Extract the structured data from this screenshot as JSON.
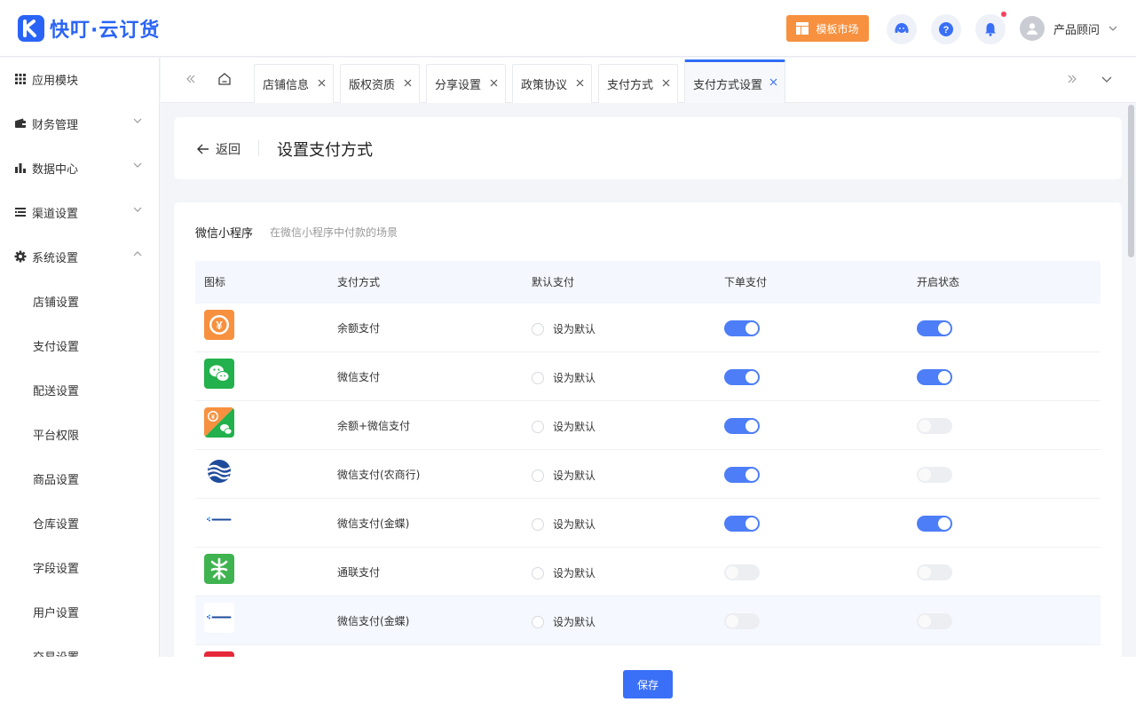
{
  "header": {
    "logo_text": "快叮·云订货",
    "template_market": "模板市场",
    "user_name": "产品顾问"
  },
  "sidebar": {
    "items": [
      {
        "label": "应用模块",
        "icon": "grid-icon"
      },
      {
        "label": "财务管理",
        "icon": "wallet-icon"
      },
      {
        "label": "数据中心",
        "icon": "bar-chart-icon"
      },
      {
        "label": "渠道设置",
        "icon": "list-icon"
      },
      {
        "label": "系统设置",
        "icon": "gear-icon",
        "expanded": true
      }
    ],
    "sub_items": [
      "店铺设置",
      "支付设置",
      "配送设置",
      "平台权限",
      "商品设置",
      "仓库设置",
      "字段设置",
      "用户设置",
      "交易设置"
    ]
  },
  "tabs": [
    {
      "label": "店铺信息"
    },
    {
      "label": "版权资质"
    },
    {
      "label": "分享设置"
    },
    {
      "label": "政策协议"
    },
    {
      "label": "支付方式"
    },
    {
      "label": "支付方式设置",
      "active": true
    }
  ],
  "page": {
    "back_label": "返回",
    "title": "设置支付方式"
  },
  "section": {
    "title": "微信小程序",
    "desc": "在微信小程序中付款的场景"
  },
  "table": {
    "headers": [
      "图标",
      "支付方式",
      "默认支付",
      "下单支付",
      "开启状态"
    ],
    "radio_label": "设为默认",
    "rows": [
      {
        "name": "余额支付",
        "icon": "balance-icon",
        "order_pay": true,
        "enabled": true
      },
      {
        "name": "微信支付",
        "icon": "wechat-icon",
        "order_pay": true,
        "enabled": true
      },
      {
        "name": "余额+微信支付",
        "icon": "balance-wechat-icon",
        "order_pay": true,
        "enabled": false
      },
      {
        "name": "微信支付(农商行)",
        "icon": "rural-bank-icon",
        "order_pay": true,
        "enabled": false
      },
      {
        "name": "微信支付(金蝶)",
        "icon": "kingdee-icon",
        "order_pay": true,
        "enabled": true
      },
      {
        "name": "通联支付",
        "icon": "allinpay-icon",
        "order_pay": false,
        "enabled": false
      },
      {
        "name": "微信支付(金蝶)",
        "icon": "kingdee-icon",
        "order_pay": false,
        "enabled": false
      }
    ]
  },
  "footer": {
    "save_label": "保存"
  },
  "colors": {
    "primary": "#3a6ff7",
    "market_orange": "#f7913f",
    "wechat_green": "#22b14c"
  }
}
